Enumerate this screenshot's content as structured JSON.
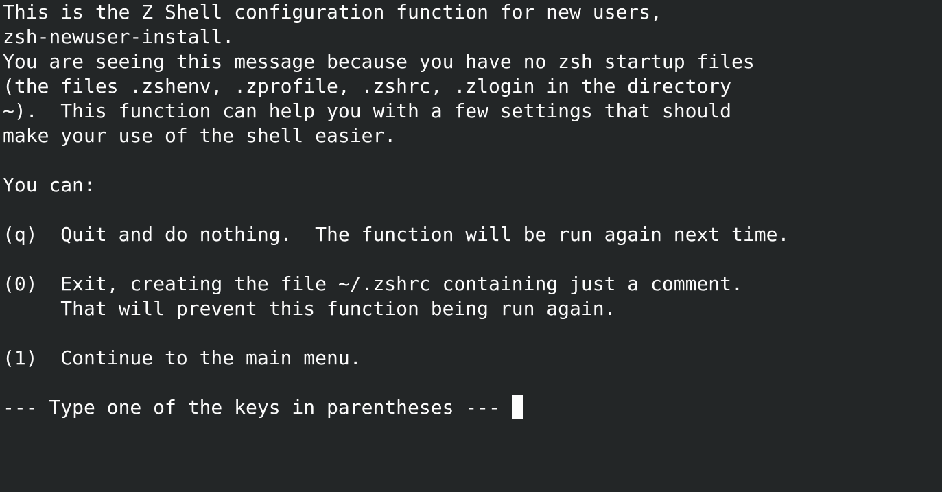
{
  "terminal": {
    "lines": [
      "This is the Z Shell configuration function for new users,",
      "zsh-newuser-install.",
      "You are seeing this message because you have no zsh startup files",
      "(the files .zshenv, .zprofile, .zshrc, .zlogin in the directory",
      "~).  This function can help you with a few settings that should",
      "make your use of the shell easier.",
      "",
      "You can:",
      "",
      "(q)  Quit and do nothing.  The function will be run again next time.",
      "",
      "(0)  Exit, creating the file ~/.zshrc containing just a comment.",
      "     That will prevent this function being run again.",
      "",
      "(1)  Continue to the main menu.",
      ""
    ],
    "prompt": "--- Type one of the keys in parentheses --- "
  }
}
